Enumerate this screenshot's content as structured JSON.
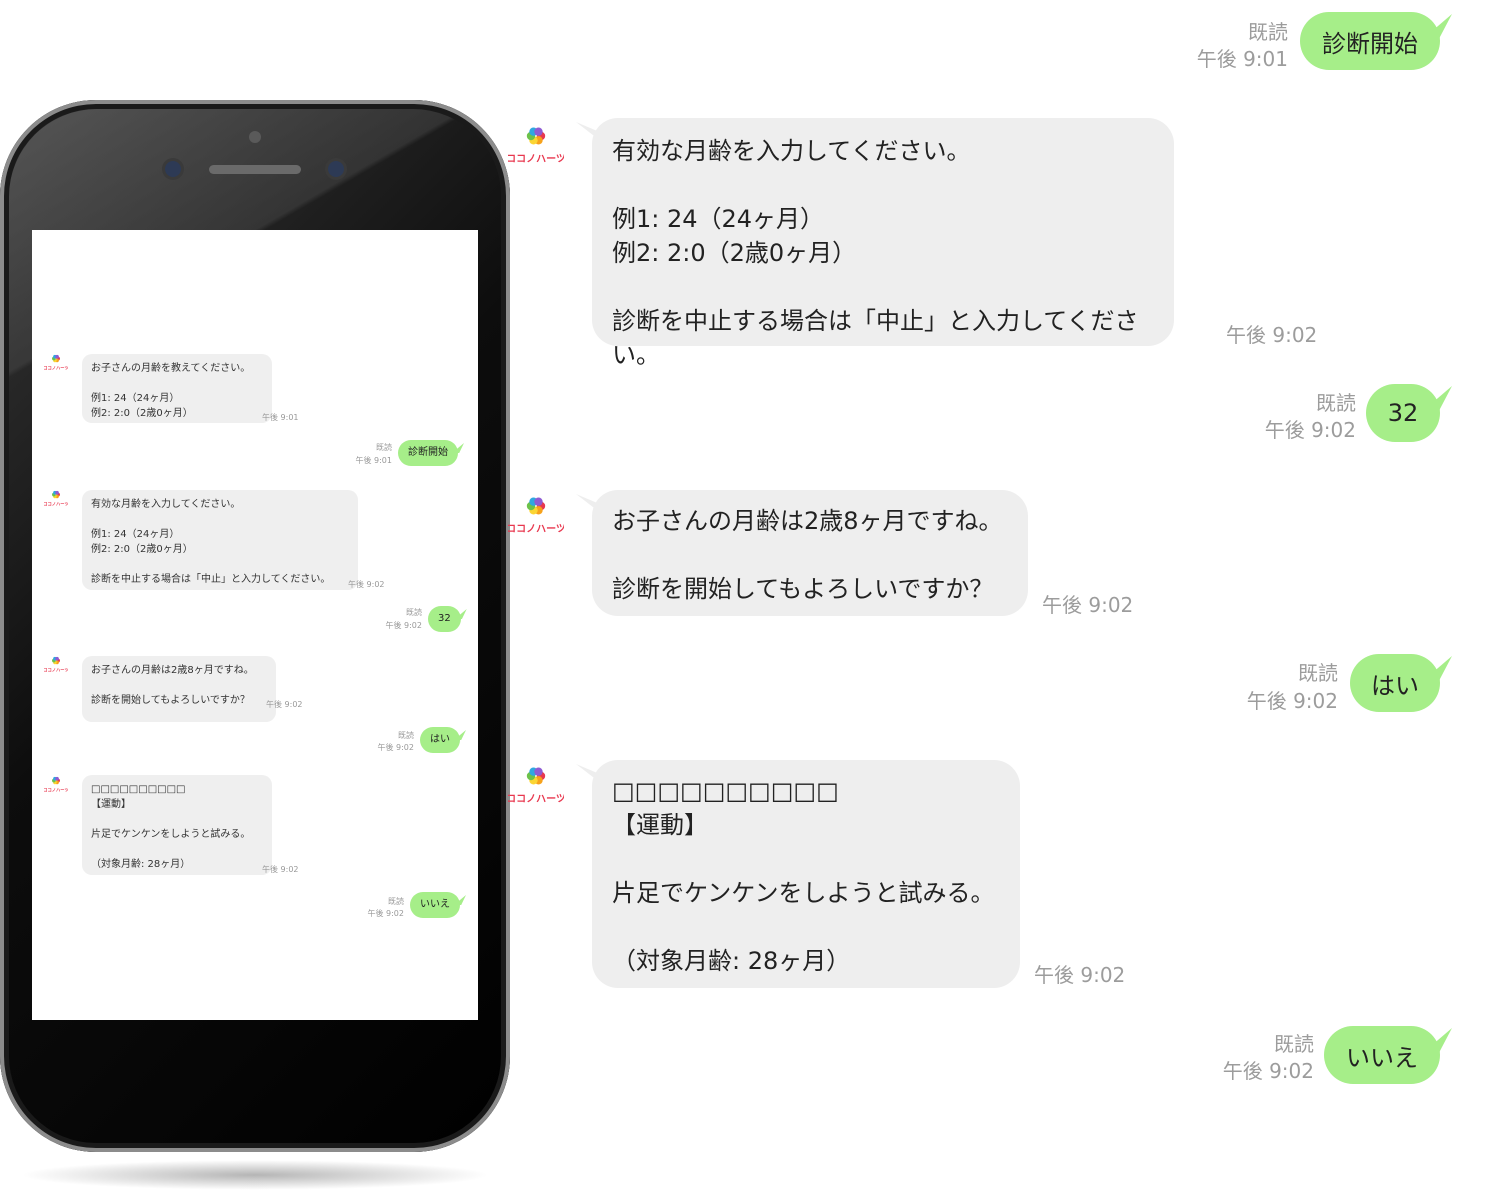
{
  "colors": {
    "bubble_green": "#a6ee89",
    "bubble_gray": "#eeeeee",
    "timestamp": "#9c9c9c"
  },
  "logo": {
    "name": "ココノハーツ",
    "petal_colors": [
      "#e8384f",
      "#f7a21b",
      "#fbd533",
      "#6cc24a",
      "#2fa7e0",
      "#8e5bd3"
    ]
  },
  "screen_chat": {
    "intro_message": "お子さんの月齢を教えてください。\n\n例1: 24（24ヶ月）\n例2: 2:0（2歳0ヶ月）",
    "intro_time": "午後 9:01",
    "start_read": "既読",
    "start_time": "午後 9:01",
    "start_label": "診断開始",
    "prompt_message": "有効な月齢を入力してください。\n\n例1: 24（24ヶ月）\n例2: 2:0（2歳0ヶ月）\n\n診断を中止する場合は「中止」と入力してください。",
    "prompt_time": "午後 9:02",
    "age_read": "既読",
    "age_time": "午後 9:02",
    "age_label": "32",
    "confirm_message": "お子さんの月齢は2歳8ヶ月ですね。\n\n診断を開始してもよろしいですか？",
    "confirm_time": "午後 9:02",
    "yes_read": "既読",
    "yes_time": "午後 9:02",
    "yes_label": "はい",
    "question_message": "□□□□□□□□□□\n【運動】\n\n片足でケンケンをしようと試みる。\n\n（対象月齢: 28ヶ月）",
    "question_time": "午後 9:02",
    "no_read": "既読",
    "no_time": "午後 9:02",
    "no_label": "いいえ"
  },
  "chat": {
    "start_read": "既読",
    "start_time": "午後 9:01",
    "start_label": "診断開始",
    "prompt_message": "有効な月齢を入力してください。\n\n例1: 24（24ヶ月）\n例2: 2:0（2歳0ヶ月）\n\n診断を中止する場合は「中止」と入力してください。",
    "prompt_time": "午後 9:02",
    "age_read": "既読",
    "age_time": "午後 9:02",
    "age_label": "32",
    "confirm_message": "お子さんの月齢は2歳8ヶ月ですね。\n\n診断を開始してもよろしいですか？",
    "confirm_time": "午後 9:02",
    "yes_read": "既読",
    "yes_time": "午後 9:02",
    "yes_label": "はい",
    "question_message": "□□□□□□□□□□\n【運動】\n\n片足でケンケンをしようと試みる。\n\n（対象月齢: 28ヶ月）",
    "question_time": "午後 9:02",
    "no_read": "既読",
    "no_time": "午後 9:02",
    "no_label": "いいえ"
  }
}
